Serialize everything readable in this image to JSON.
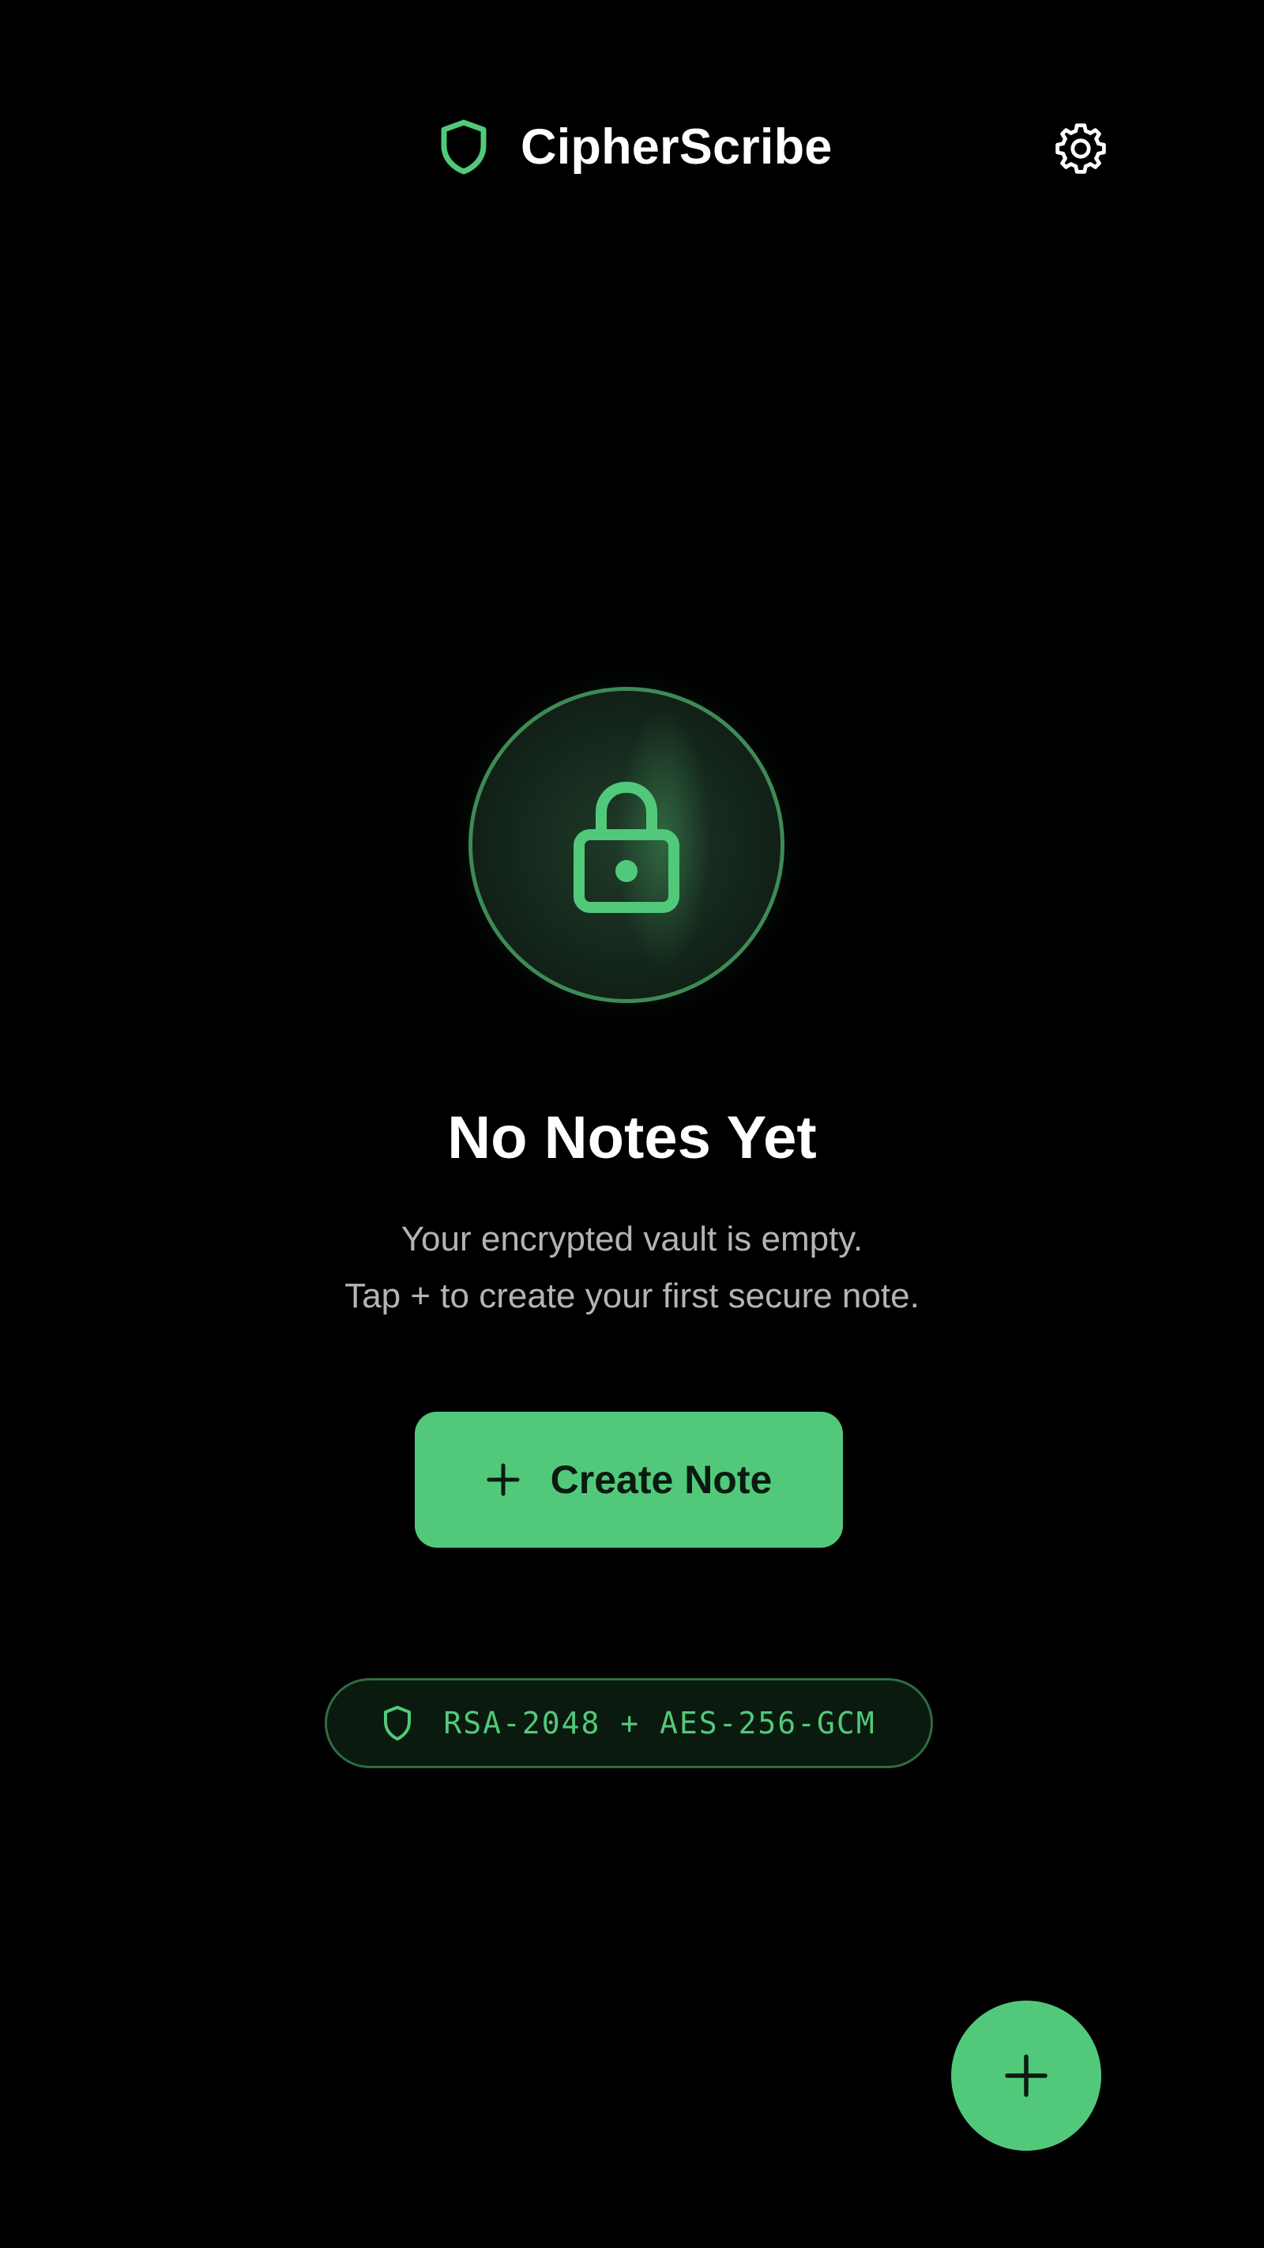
{
  "header": {
    "app_title": "CipherScribe",
    "brand_icon": "shield-icon",
    "settings_icon": "gear-icon"
  },
  "empty_state": {
    "icon": "lock-icon",
    "title": "No Notes Yet",
    "line1": "Your encrypted vault is empty.",
    "line2": "Tap + to create your first secure note."
  },
  "create_button": {
    "icon": "plus-icon",
    "label": "Create Note"
  },
  "encryption_badge": {
    "icon": "shield-icon",
    "text": "RSA-2048 + AES-256-GCM"
  },
  "fab": {
    "icon": "plus-icon"
  },
  "colors": {
    "background": "#000000",
    "accent": "#52c97a",
    "accent_dark": "#3e8a57",
    "text_primary": "#ffffff",
    "text_secondary": "#b4b4b4"
  }
}
